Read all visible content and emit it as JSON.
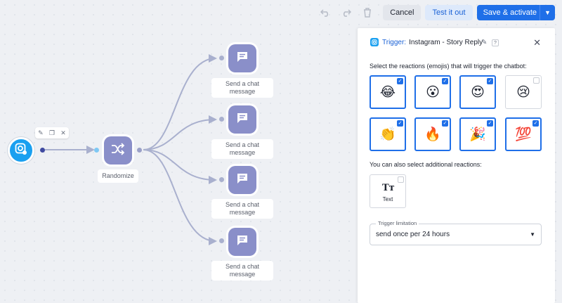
{
  "toolbar": {
    "undo_icon": "undo-icon",
    "redo_icon": "redo-icon",
    "delete_icon": "trash-icon",
    "cancel_label": "Cancel",
    "test_label": "Test it out",
    "save_label": "Save & activate"
  },
  "flow": {
    "start_icon": "instagram-trigger-icon",
    "randomize_label": "Randomize",
    "messages": [
      {
        "label_line1": "Send a chat",
        "label_line2": "message"
      },
      {
        "label_line1": "Send a chat",
        "label_line2": "message"
      },
      {
        "label_line1": "Send a chat",
        "label_line2": "message"
      },
      {
        "label_line1": "Send a chat",
        "label_line2": "message"
      }
    ]
  },
  "panel": {
    "kind": "Trigger:",
    "title": "Instagram - Story Reply",
    "reactions_heading": "Select the reactions (emojis) that will trigger the chatbot:",
    "reactions": [
      {
        "emoji": "😂",
        "selected": true
      },
      {
        "emoji": "😮",
        "selected": true
      },
      {
        "emoji": "😍",
        "selected": true
      },
      {
        "emoji": "😢",
        "selected": false
      },
      {
        "emoji": "👏",
        "selected": true
      },
      {
        "emoji": "🔥",
        "selected": true
      },
      {
        "emoji": "🎉",
        "selected": true
      },
      {
        "emoji": "💯",
        "selected": true
      }
    ],
    "additional_heading": "You can also select additional reactions:",
    "text_option": {
      "glyph": "Tт",
      "label": "Text",
      "selected": false
    },
    "limitation_legend": "Trigger limitation",
    "limitation_value": "send once per 24 hours"
  },
  "colors": {
    "primary": "#1f6fe8",
    "node": "#8a8fc9",
    "trigger": "#1aa0f0",
    "connector": "#a9b0ce"
  }
}
